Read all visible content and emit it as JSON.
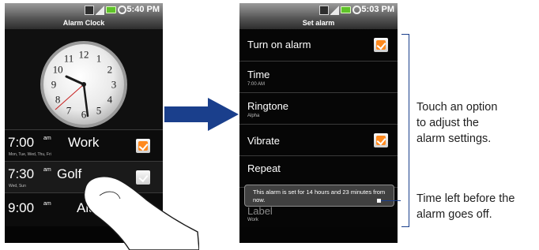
{
  "phone1": {
    "status_time": "5:40 PM",
    "title": "Alarm Clock",
    "clock_numbers": [
      "12",
      "1",
      "2",
      "3",
      "4",
      "5",
      "6",
      "7",
      "8",
      "9",
      "10",
      "11"
    ],
    "alarms": [
      {
        "time": "7:00",
        "ampm": "am",
        "label": "Work",
        "days": "Mon, Tue, Wed, Thu, Fri",
        "enabled": true
      },
      {
        "time": "7:30",
        "ampm": "am",
        "label": "Golf",
        "days": "Wed, Sun",
        "enabled": false
      },
      {
        "time": "9:00",
        "ampm": "am",
        "label": "Alarm",
        "days": "",
        "enabled": false
      }
    ]
  },
  "phone2": {
    "status_time": "5:03 PM",
    "title": "Set alarm",
    "items": [
      {
        "title": "Turn on alarm",
        "subtitle": "",
        "checkbox": true
      },
      {
        "title": "Time",
        "subtitle": "7:00 AM",
        "checkbox": false
      },
      {
        "title": "Ringtone",
        "subtitle": "Alpha",
        "checkbox": false
      },
      {
        "title": "Vibrate",
        "subtitle": "",
        "checkbox": true
      },
      {
        "title": "Repeat",
        "subtitle": "",
        "checkbox": false
      },
      {
        "title": "Label",
        "subtitle": "Work",
        "checkbox": false
      }
    ],
    "toast": "This alarm is set for 14 hours and 23 minutes from now."
  },
  "annotations": {
    "options_note": [
      "Touch an option",
      "to adjust the",
      "alarm settings."
    ],
    "toast_note": [
      "Time left before the",
      "alarm goes off."
    ]
  },
  "colors": {
    "accent": "#ff8a1f",
    "arrow": "#1a3f8c"
  }
}
